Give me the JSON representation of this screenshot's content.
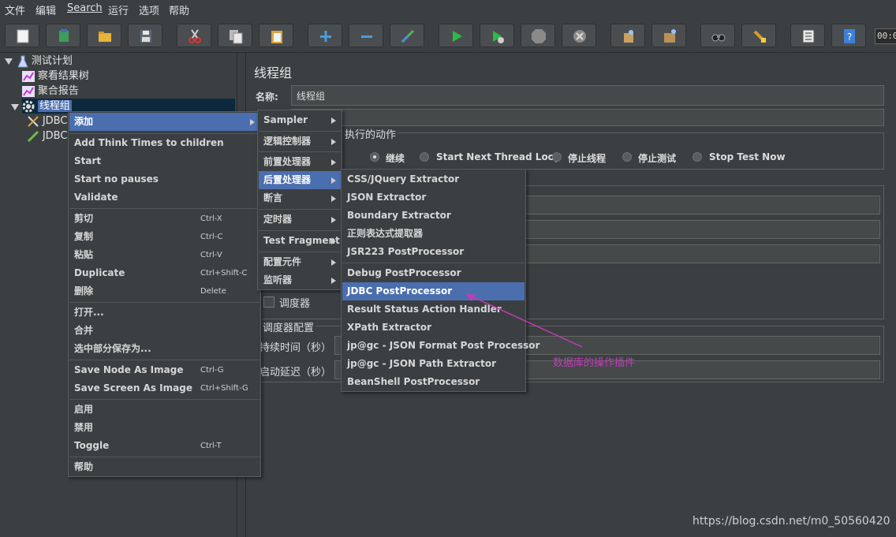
{
  "menubar": [
    "文件",
    "编辑",
    "Search",
    "运行",
    "选项",
    "帮助"
  ],
  "toolbar": {
    "icons": [
      "new-icon",
      "templates-icon",
      "open-icon",
      "save-icon",
      "cut-icon",
      "copy-icon",
      "paste-icon",
      "expand-icon",
      "collapse-icon",
      "toggle-icon",
      "start-icon",
      "start-no-pause-icon",
      "stop-icon",
      "shutdown-icon",
      "clear-icon",
      "clear-all-icon",
      "search-icon",
      "reset-search-icon",
      "function-helper-icon",
      "help-icon"
    ],
    "counter": "00:0"
  },
  "tree": {
    "items": [
      {
        "label": "测试计划",
        "icon": "flask-icon"
      },
      {
        "label": "察看结果树",
        "icon": "graph-icon"
      },
      {
        "label": "聚合报告",
        "icon": "graph-icon"
      },
      {
        "label": "线程组",
        "icon": "gear-icon"
      },
      {
        "label": "JDBC",
        "icon": "tools-icon"
      },
      {
        "label": "JDBC",
        "icon": "pencil-icon"
      }
    ]
  },
  "panel": {
    "title": "线程组",
    "name_label": "名称:",
    "name_value": "线程组",
    "action_group": "执行的动作",
    "actions": [
      "继续",
      "Start Next Thread Loop",
      "停止线程",
      "停止测试",
      "Stop Test Now"
    ],
    "scheduler_label": "调度器",
    "scheduler_config": "调度器配置",
    "duration_label": "持续时间（秒）",
    "delay_label": "启动延迟（秒）"
  },
  "context_menu": {
    "items": [
      {
        "label": "添加",
        "shortcut": "",
        "submenu": true
      },
      {
        "label": "Add Think Times to children",
        "shortcut": ""
      },
      {
        "label": "Start",
        "shortcut": ""
      },
      {
        "label": "Start no pauses",
        "shortcut": ""
      },
      {
        "label": "Validate",
        "shortcut": ""
      },
      {
        "label": "剪切",
        "shortcut": "Ctrl-X"
      },
      {
        "label": "复制",
        "shortcut": "Ctrl-C"
      },
      {
        "label": "粘贴",
        "shortcut": "Ctrl-V"
      },
      {
        "label": "Duplicate",
        "shortcut": "Ctrl+Shift-C"
      },
      {
        "label": "删除",
        "shortcut": "Delete"
      },
      {
        "label": "打开...",
        "shortcut": ""
      },
      {
        "label": "合并",
        "shortcut": ""
      },
      {
        "label": "选中部分保存为...",
        "shortcut": ""
      },
      {
        "label": "Save Node As Image",
        "shortcut": "Ctrl-G"
      },
      {
        "label": "Save Screen As Image",
        "shortcut": "Ctrl+Shift-G"
      },
      {
        "label": "启用",
        "shortcut": ""
      },
      {
        "label": "禁用",
        "shortcut": ""
      },
      {
        "label": "Toggle",
        "shortcut": "Ctrl-T"
      },
      {
        "label": "帮助",
        "shortcut": ""
      }
    ]
  },
  "add_menu": {
    "items": [
      "Sampler",
      "逻辑控制器",
      "前置处理器",
      "后置处理器",
      "断言",
      "定时器",
      "Test Fragment",
      "配置元件",
      "监听器"
    ]
  },
  "post_menu": {
    "items": [
      "CSS/JQuery Extractor",
      "JSON Extractor",
      "Boundary Extractor",
      "正则表达式提取器",
      "JSR223 PostProcessor",
      "Debug PostProcessor",
      "JDBC PostProcessor",
      "Result Status Action Handler",
      "XPath Extractor",
      "jp@gc - JSON Format Post Processor",
      "jp@gc - JSON Path Extractor",
      "BeanShell PostProcessor"
    ]
  },
  "annotation": "数据库的操作插件",
  "watermark": "https://blog.csdn.net/m0_50560420",
  "colors": {
    "highlight": "#4b6eaf",
    "annotation": "#c23bb8",
    "background": "#3c3f41"
  }
}
